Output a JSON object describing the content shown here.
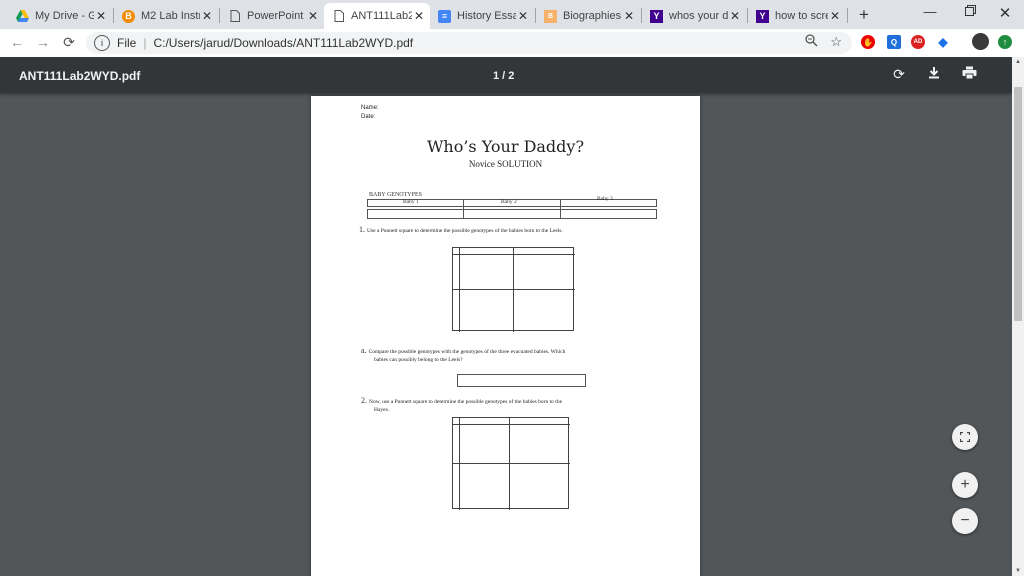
{
  "tabs": [
    {
      "title": "My Drive - G",
      "icon": "google-drive-icon",
      "active": false
    },
    {
      "title": "M2 Lab Instr",
      "icon": "blackboard-icon",
      "active": false
    },
    {
      "title": "PowerPoint P",
      "icon": "document-icon",
      "active": false
    },
    {
      "title": "ANT111Lab2",
      "icon": "document-icon",
      "active": true
    },
    {
      "title": "History Essa",
      "icon": "google-docs-icon",
      "active": false
    },
    {
      "title": "Biographies",
      "icon": "biographies-icon",
      "active": false
    },
    {
      "title": "whos your d",
      "icon": "yahoo-icon",
      "active": false
    },
    {
      "title": "how to scree",
      "icon": "yahoo-icon",
      "active": false
    }
  ],
  "toolbar": {
    "scheme": "File",
    "url": "C:/Users/jarud/Downloads/ANT111Lab2WYD.pdf"
  },
  "pdf": {
    "filename": "ANT111Lab2WYD.pdf",
    "page_indicator": "1 / 2"
  },
  "document": {
    "name_label": "Name:",
    "date_label": "Date:",
    "title": "Who’s Your Daddy?",
    "subtitle": "Novice SOLUTION",
    "table_heading": "BABY GENOTYPES",
    "babies": [
      "Baby 1",
      "Baby 2",
      "Baby 3"
    ],
    "q1_num": "1.",
    "q1": "Use a Punnett square to determine the possible genotypes of the babies born to the Leels.",
    "qa_num": "a.",
    "qa_line1": "Compare the possible genotypes with the genotypes of the three evacuated babies. Which",
    "qa_line2": "babies can possibly belong to the Leels?",
    "q2_num": "2.",
    "q2_line1": "Now, use a Punnett square to determine the possible genotypes of the babies born to the",
    "q2_line2": "Hayes."
  },
  "colors": {
    "tabstrip": "#dee1e6",
    "pdf_toolbar": "#323639",
    "viewer_bg": "#525659"
  }
}
